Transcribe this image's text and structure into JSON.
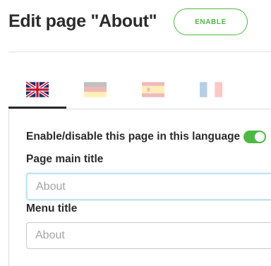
{
  "header": {
    "title": "Edit page \"About\"",
    "enable_label": "ENABLE"
  },
  "tabs": [
    {
      "flag": "uk-flag-icon",
      "active": true
    },
    {
      "flag": "germany-flag-icon",
      "active": false
    },
    {
      "flag": "spain-flag-icon",
      "active": false
    },
    {
      "flag": "france-flag-icon",
      "active": false
    }
  ],
  "form": {
    "toggle_label": "Enable/disable this page in this language",
    "toggle_on": true,
    "main_title_label": "Page main title",
    "main_title_placeholder": "About",
    "menu_title_label": "Menu title",
    "menu_title_placeholder": "About"
  },
  "colors": {
    "accent": "#4cb944",
    "text": "#2b2b2b",
    "focus": "#bfe3f2"
  }
}
